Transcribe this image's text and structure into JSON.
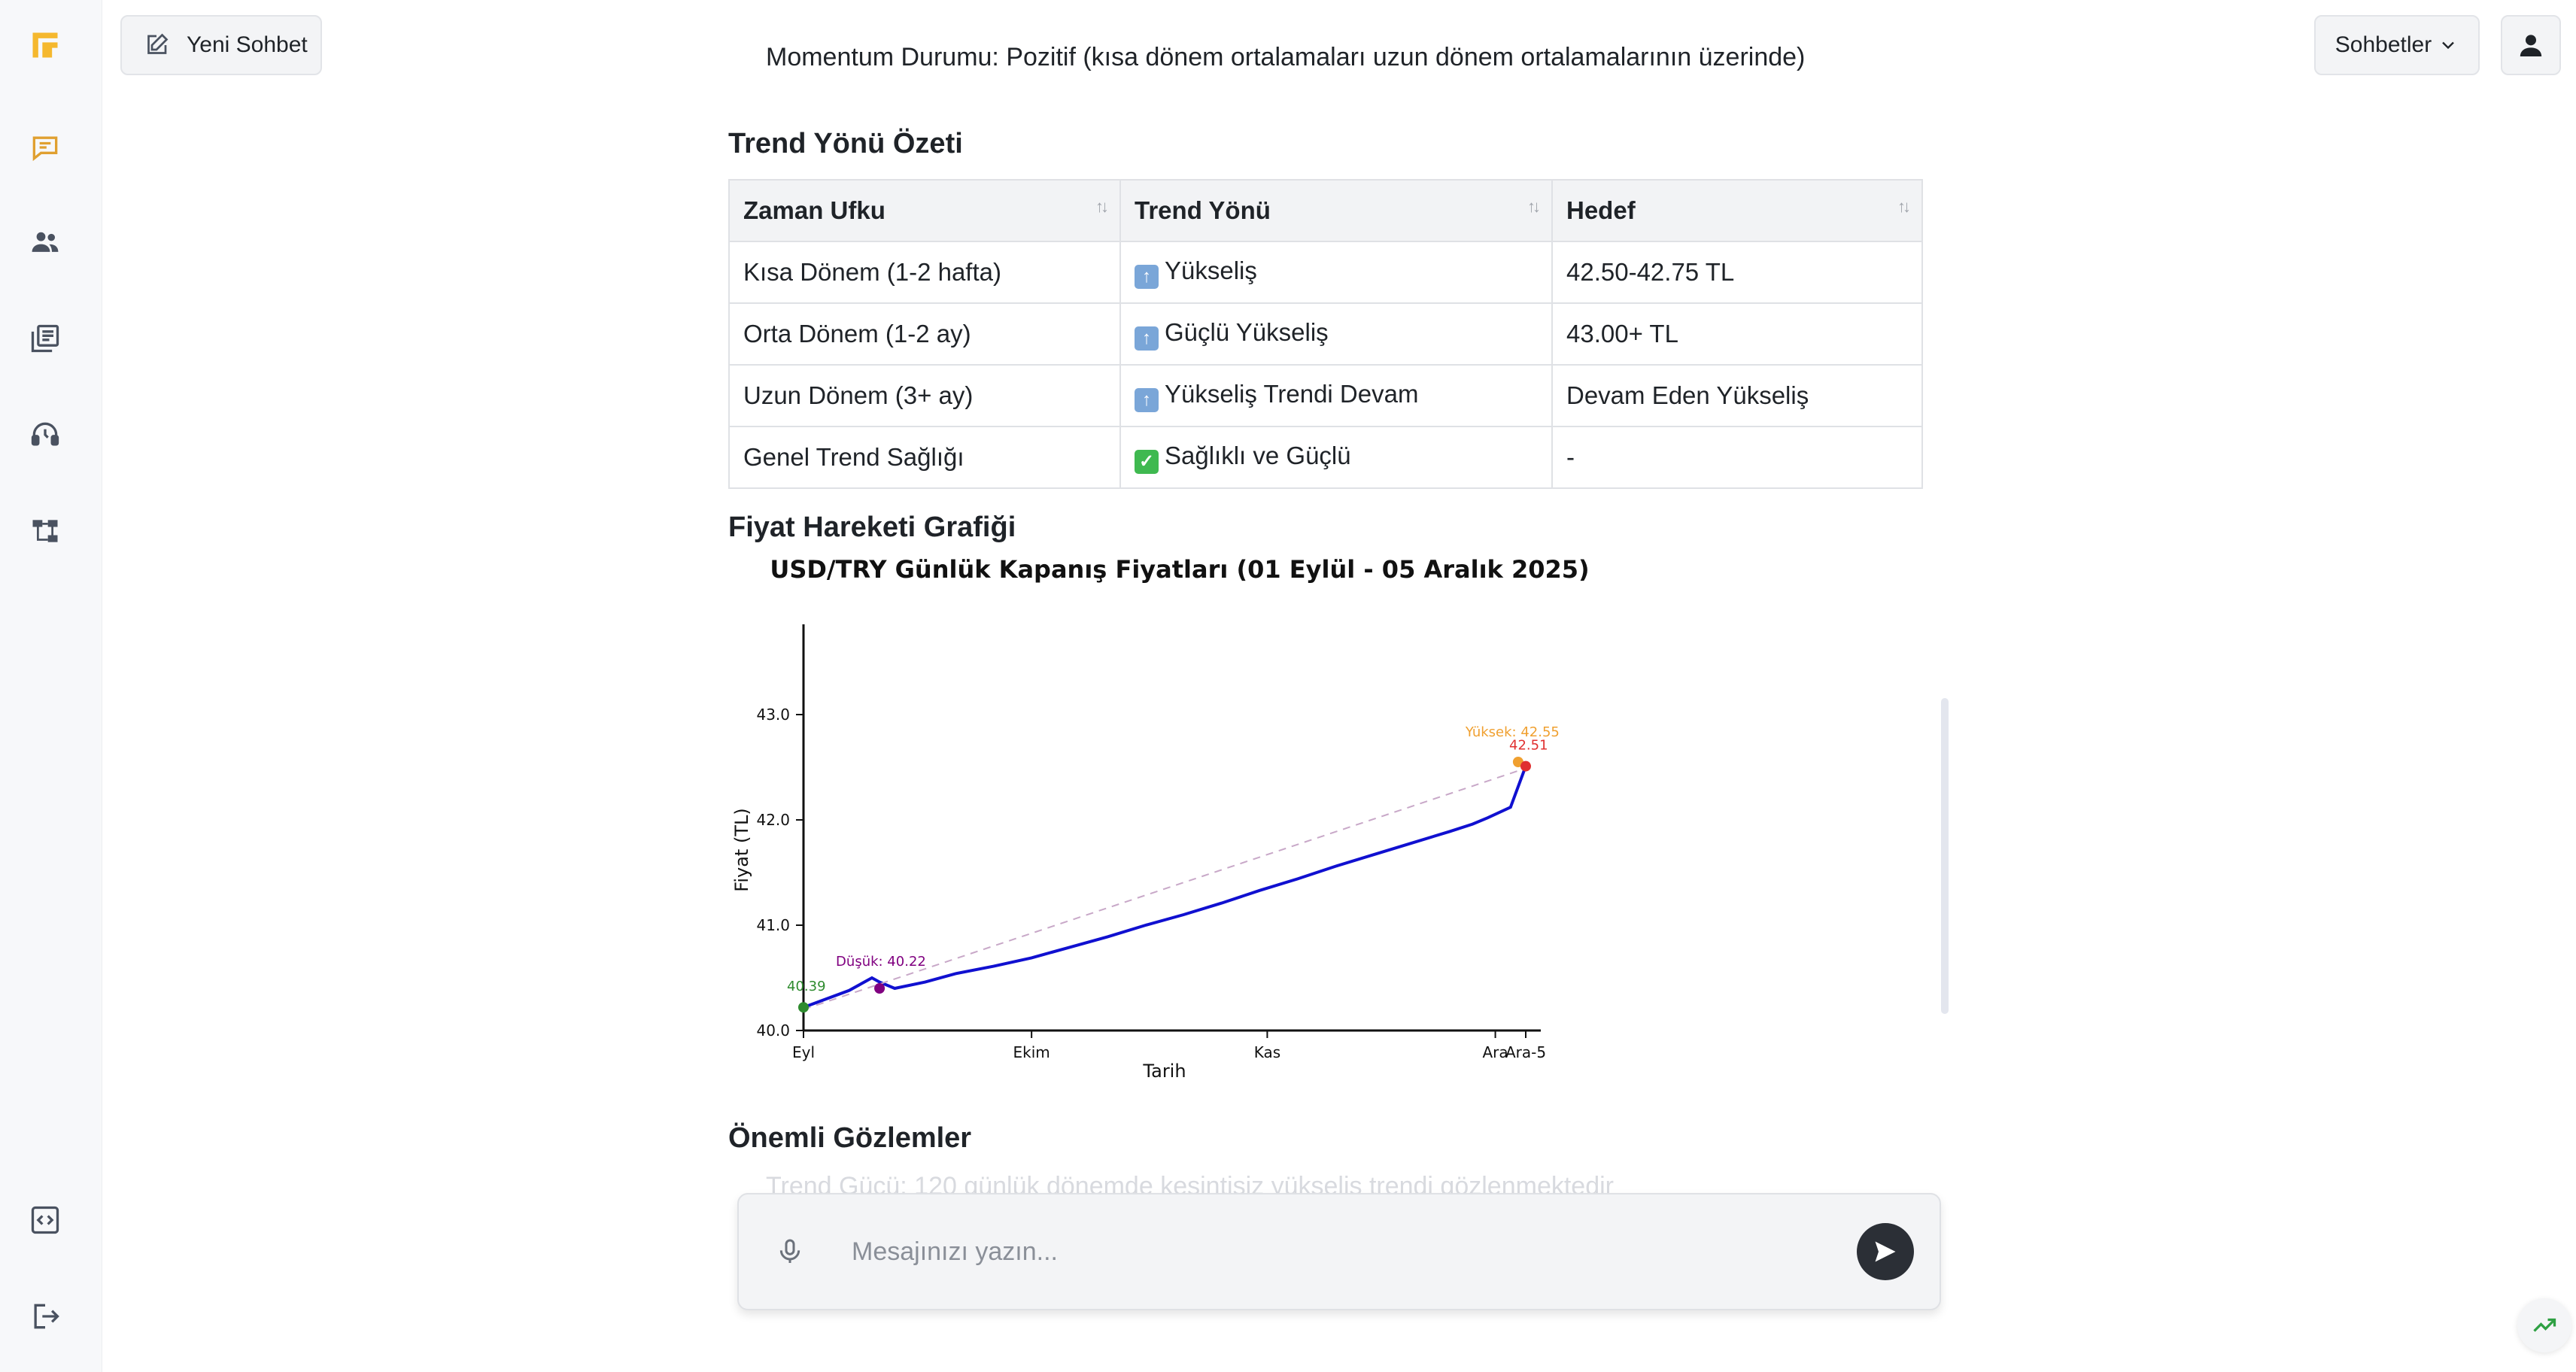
{
  "header": {
    "new_chat_label": "Yeni Sohbet",
    "chats_label": "Sohbetler"
  },
  "sidebar": {
    "icons": [
      "logo-icon",
      "chat-icon",
      "users-icon",
      "library-icon",
      "support-agent-icon",
      "workflow-icon",
      "code-icon",
      "logout-icon"
    ],
    "accent_color": "#f5b82e"
  },
  "content": {
    "cutoff_text": "Momentum Durumu: Pozitif (kısa dönem ortalamaları uzun dönem ortalamalarının üzerinde)",
    "section_trend_title": "Trend Yönü Özeti",
    "table": {
      "headers": [
        "Zaman Ufku",
        "Trend Yönü",
        "Hedef"
      ],
      "rows": [
        {
          "horizon": "Kısa Dönem (1-2 hafta)",
          "direction": "Yükseliş",
          "target": "42.50-42.75 TL",
          "icon": "up-arrow"
        },
        {
          "horizon": "Orta Dönem (1-2 ay)",
          "direction": "Güçlü Yükseliş",
          "target": "43.00+ TL",
          "icon": "up-arrow"
        },
        {
          "horizon": "Uzun Dönem (3+ ay)",
          "direction": "Yükseliş Trendi Devam",
          "target": "Devam Eden Yükseliş",
          "icon": "up-arrow"
        },
        {
          "horizon": "Genel Trend Sağlığı",
          "direction": "Sağlıklı ve Güçlü",
          "target": "-",
          "icon": "check"
        }
      ]
    },
    "section_chart_title": "Fiyat Hareketi Grafiği",
    "section_obs_title": "Önemli Gözlemler",
    "faded_text": "Trend Gücü: 120 günlük dönemde kesintisiz yükseliş trendi gözlenmektedir"
  },
  "chart_data": {
    "type": "line",
    "title": "USD/TRY Günlük Kapanış Fiyatları (01 Eylül - 05 Aralık 2025)",
    "xlabel": "Tarih",
    "ylabel": "Fiyat (TL)",
    "ylim": [
      40.0,
      44.0
    ],
    "y_ticks": [
      "40.0",
      "41.0",
      "42.0",
      "43.0"
    ],
    "x_ticks": [
      "Eyl",
      "Ekim",
      "Kas",
      "Ara",
      "Ara-5"
    ],
    "x_range_days": [
      0,
      95
    ],
    "x_tick_days": [
      0,
      30,
      61,
      91,
      95
    ],
    "grid": false,
    "series": [
      {
        "name": "",
        "color": "#1010d0",
        "x_days": [
          0,
          3,
          6,
          9,
          10,
          12,
          16,
          20,
          25,
          30,
          35,
          40,
          45,
          50,
          55,
          60,
          65,
          70,
          75,
          80,
          85,
          88,
          90,
          93,
          95
        ],
        "values": [
          40.22,
          40.3,
          40.38,
          40.5,
          40.46,
          40.4,
          40.46,
          40.54,
          40.61,
          40.69,
          40.79,
          40.89,
          41.0,
          41.1,
          41.21,
          41.33,
          41.44,
          41.56,
          41.67,
          41.78,
          41.89,
          41.96,
          42.02,
          42.12,
          42.51
        ]
      },
      {
        "name": "",
        "color": "#c8a8c8",
        "style": "dashed",
        "x_days": [
          0,
          95
        ],
        "values": [
          40.2,
          42.49
        ]
      }
    ],
    "markers": [
      {
        "label": "40.39",
        "x_day": 0,
        "value": 40.22,
        "color": "#2e8b2e"
      },
      {
        "label": "Düşük: 40.22",
        "x_day": 10,
        "value": 40.4,
        "color": "#800080"
      },
      {
        "label": "Yüksek: 42.55",
        "x_day": 94,
        "value": 42.55,
        "color": "#f0a030"
      },
      {
        "label": "42.51",
        "x_day": 95,
        "value": 42.51,
        "color": "#e03030"
      }
    ]
  },
  "input": {
    "placeholder": "Mesajınızı yazın..."
  }
}
